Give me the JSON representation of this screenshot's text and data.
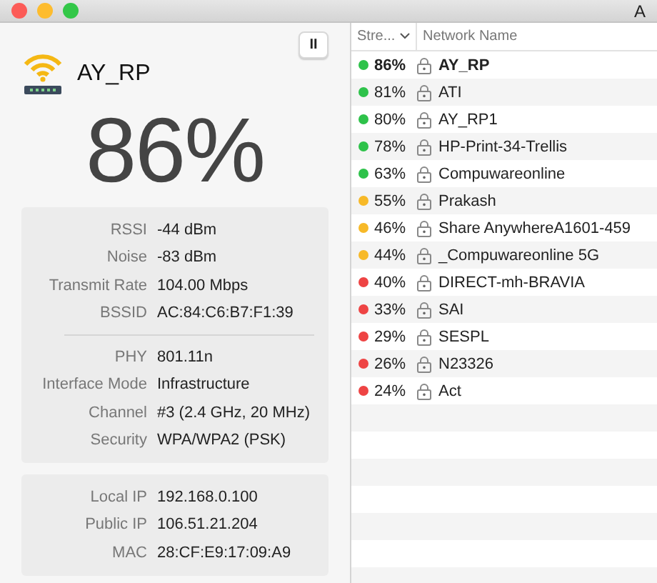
{
  "window": {
    "title": "A"
  },
  "current": {
    "name": "AY_RP",
    "strength": "86%",
    "pause_symbol": "II"
  },
  "details": [
    {
      "rows": [
        {
          "label": "RSSI",
          "value": "-44 dBm"
        },
        {
          "label": "Noise",
          "value": "-83 dBm"
        },
        {
          "label": "Transmit Rate",
          "value": "104.00 Mbps"
        },
        {
          "label": "BSSID",
          "value": "AC:84:C6:B7:F1:39"
        }
      ]
    },
    {
      "rows": [
        {
          "label": "PHY",
          "value": "801.11n"
        },
        {
          "label": "Interface Mode",
          "value": "Infrastructure"
        },
        {
          "label": "Channel",
          "value": "#3 (2.4 GHz, 20 MHz)"
        },
        {
          "label": "Security",
          "value": "WPA/WPA2 (PSK)"
        }
      ]
    }
  ],
  "addresses": [
    {
      "label": "Local IP",
      "value": "192.168.0.100"
    },
    {
      "label": "Public IP",
      "value": "106.51.21.204"
    },
    {
      "label": "MAC",
      "value": "28:CF:E9:17:09:A9"
    }
  ],
  "table": {
    "columns": [
      {
        "label": "Stre...",
        "sorted": true
      },
      {
        "label": "Network Name",
        "sorted": false
      }
    ],
    "rows": [
      {
        "strength": "86%",
        "name": "AY_RP",
        "color": "#2ec24a",
        "selected": true
      },
      {
        "strength": "81%",
        "name": "ATI",
        "color": "#2ec24a",
        "selected": false
      },
      {
        "strength": "80%",
        "name": "AY_RP1",
        "color": "#2ec24a",
        "selected": false
      },
      {
        "strength": "78%",
        "name": "HP-Print-34-Trellis",
        "color": "#2ec24a",
        "selected": false
      },
      {
        "strength": "63%",
        "name": "Compuwareonline",
        "color": "#2ec24a",
        "selected": false
      },
      {
        "strength": "55%",
        "name": "Prakash",
        "color": "#f7b928",
        "selected": false
      },
      {
        "strength": "46%",
        "name": "Share AnywhereA1601-459",
        "color": "#f7b928",
        "selected": false
      },
      {
        "strength": "44%",
        "name": "_Compuwareonline 5G",
        "color": "#f7b928",
        "selected": false
      },
      {
        "strength": "40%",
        "name": "DIRECT-mh-BRAVIA",
        "color": "#ee4444",
        "selected": false
      },
      {
        "strength": "33%",
        "name": "SAI",
        "color": "#ee4444",
        "selected": false
      },
      {
        "strength": "29%",
        "name": "SESPL",
        "color": "#ee4444",
        "selected": false
      },
      {
        "strength": "26%",
        "name": "N23326",
        "color": "#ee4444",
        "selected": false
      },
      {
        "strength": "24%",
        "name": "Act",
        "color": "#ee4444",
        "selected": false
      }
    ]
  }
}
